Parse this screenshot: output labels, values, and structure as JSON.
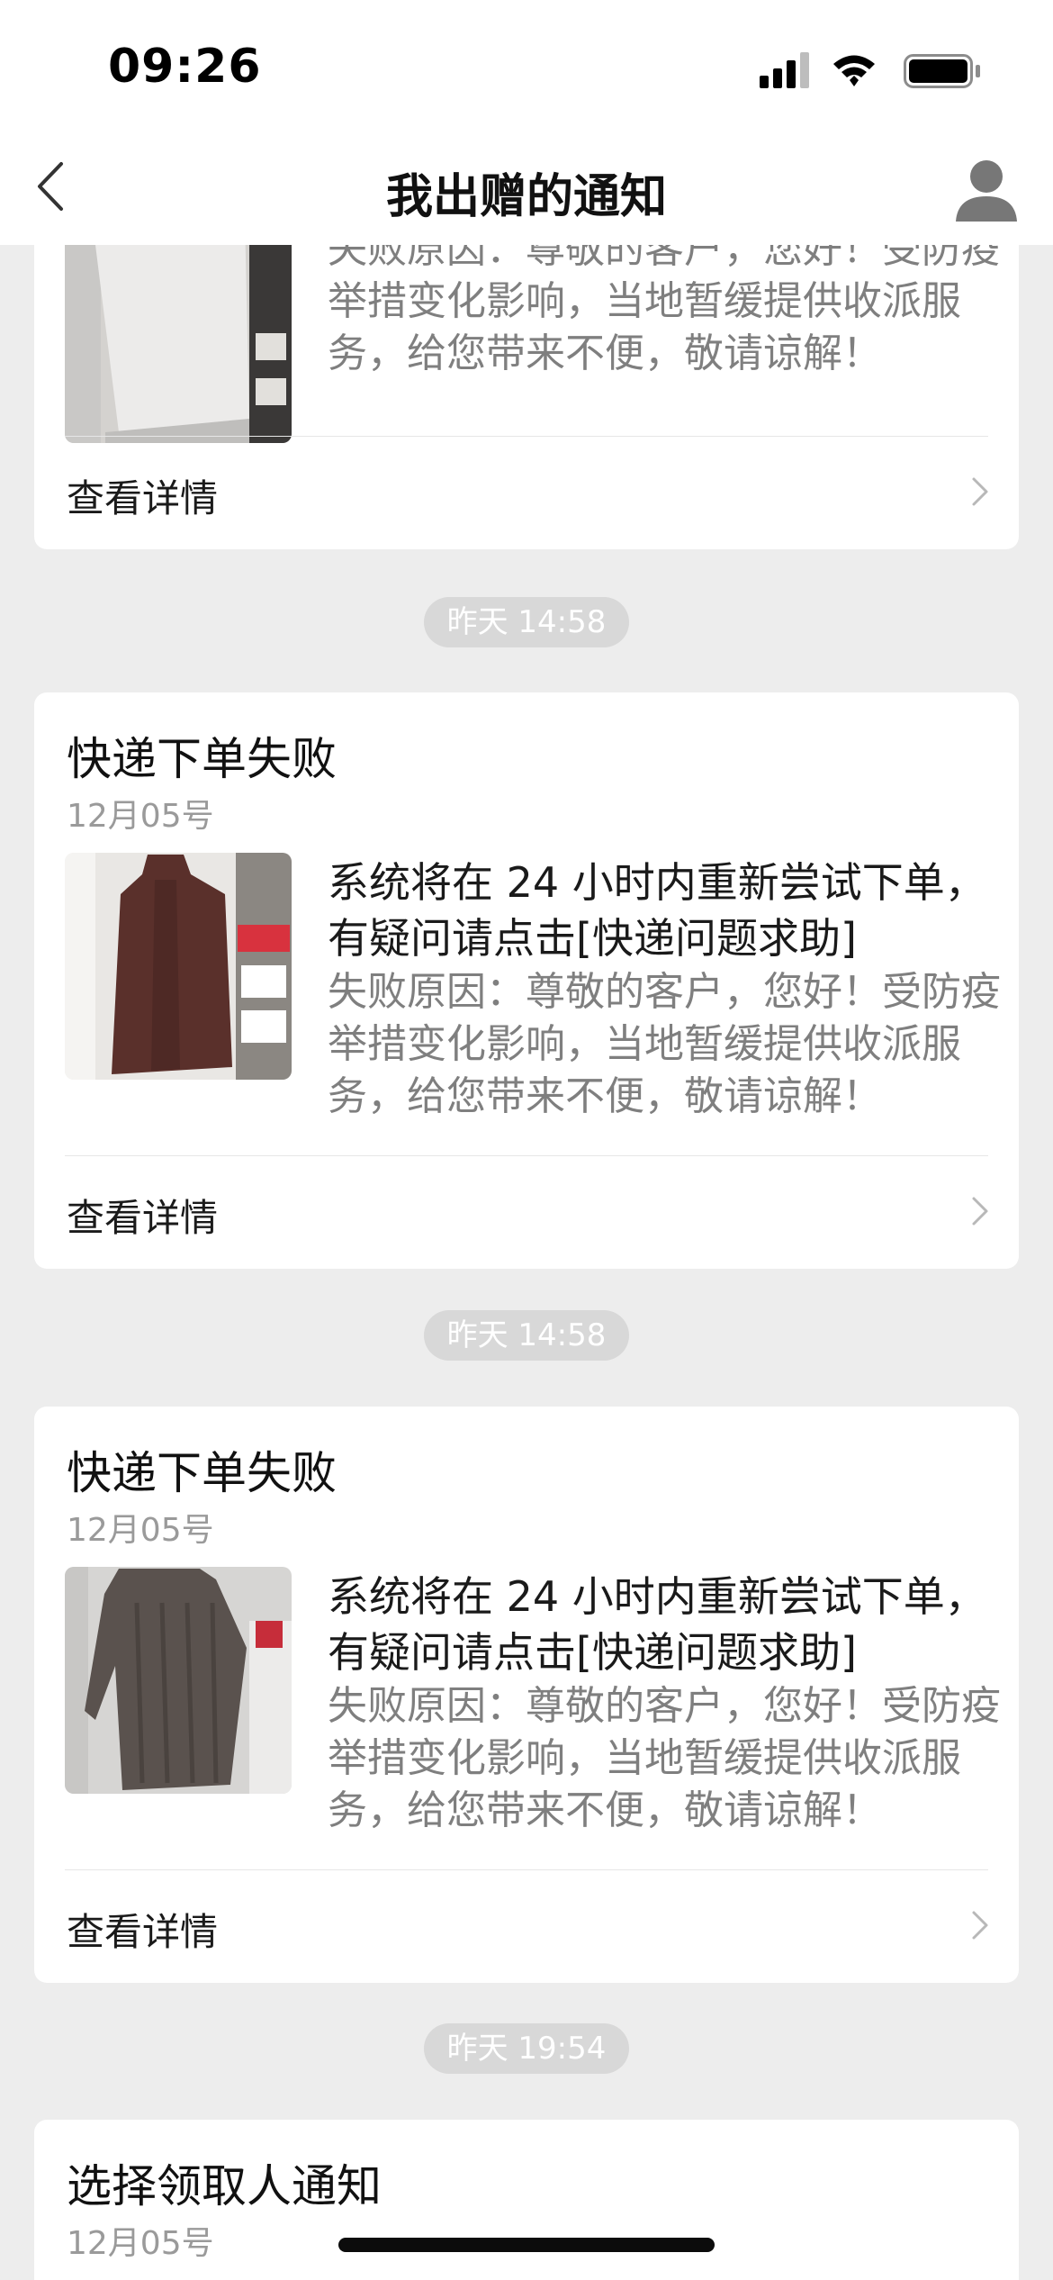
{
  "status_bar": {
    "time": "09:26",
    "icons": [
      "cellular-signal-icon",
      "wifi-icon",
      "battery-icon"
    ]
  },
  "nav": {
    "title": "我出赠的通知",
    "back_icon": "chevron-left-icon",
    "profile_icon": "person-icon"
  },
  "cards": [
    {
      "title": "",
      "date": "",
      "headline": "",
      "description": "失败原因：尊敬的客户，您好！受防疫举措变化影响，当地暂缓提供收派服务，给您带来不便，敬请谅解！",
      "link_label": "查看详情",
      "thumbnail": "white-sweater-dress-photo"
    },
    {
      "timestamp": "昨天 14:58",
      "title": "快递下单失败",
      "date": "12月05号",
      "headline": "系统将在 24 小时内重新尝试下单，有疑问请点击[快递问题求助]",
      "description": "失败原因：尊敬的客户，您好！受防疫举措变化影响，当地暂缓提供收派服务，给您带来不便，敬请谅解！",
      "link_label": "查看详情",
      "thumbnail": "brown-dress-photo"
    },
    {
      "timestamp": "昨天 14:58",
      "title": "快递下单失败",
      "date": "12月05号",
      "headline": "系统将在 24 小时内重新尝试下单，有疑问请点击[快递问题求助]",
      "description": "失败原因：尊敬的客户，您好！受防疫举措变化影响，当地暂缓提供收派服务，给您带来不便，敬请谅解！",
      "link_label": "查看详情",
      "thumbnail": "gray-sweater-photo"
    },
    {
      "timestamp": "昨天 19:54",
      "title": "选择领取人通知",
      "date": "12月05号"
    }
  ],
  "colors": {
    "background": "#ededed",
    "card": "#ffffff",
    "secondary_text": "#7f7f7f",
    "pill": "#d8d8d8"
  }
}
